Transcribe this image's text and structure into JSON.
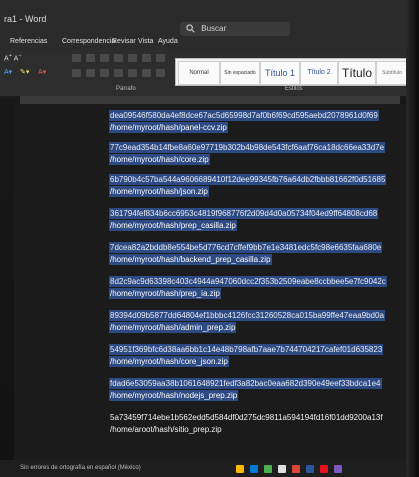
{
  "window": {
    "title": "ra1 - Word",
    "search_label": "Buscar"
  },
  "menu": {
    "items": [
      "Referencias",
      "Correspondencia",
      "Revisar",
      "Vista",
      "Ayuda"
    ]
  },
  "ribbon": {
    "group_paragraph": "Párrafo",
    "group_styles": "Estilos",
    "styles": [
      {
        "label": "Normal"
      },
      {
        "label": "Sin espaciado"
      },
      {
        "label": "Título 1"
      },
      {
        "label": "Título 2"
      },
      {
        "label": "Título"
      },
      {
        "label": "Subtítulo"
      }
    ]
  },
  "document": {
    "entries": [
      {
        "hash": "dea09546f580da4ef8dce67ac5d65998d7af0b6f69cd595aebd2078961d0f69",
        "path": "/home/myroot/hash/panel-ccv.zip"
      },
      {
        "hash": "77c9ead354b14fbe8a60e97719b302b4b98de543fcf6aaf76ca18dc66ea33d7e",
        "path": "/home/myroot/hash/core.zip"
      },
      {
        "hash": "6b790b4c57ba544a9606689410f12dee99345fb76a64db2fbbb81662f0d51685",
        "path": "/home/myroot/hash/json.zip"
      },
      {
        "hash": "361794fef834b6cc6953c4819f968776f2d09d4d0a05734f04ed9ff64808cd68",
        "path": "/home/myroot/hash/prep_casilla.zip"
      },
      {
        "hash": "7dcea82a2bddb8e554be5d776cd7cffef9bb7e1e3481edc5fc98e6635faa680e",
        "path": "/home/myroot/hash/backend_prep_casilla.zip"
      },
      {
        "hash": "8d2c9ac9d63398c403c4944a947060dcc2f353b2509eabe8ccbbee5e7fc9042c",
        "path": "/home/myroot/hash/prep_ia.zip"
      },
      {
        "hash": "89394d09b5877dd64804ef1bbbc4126fcc31260528ca015ba99ffe47eaa9bd0a",
        "path": "/home/myroot/hash/admin_prep.zip"
      },
      {
        "hash": "54951f369bfc6d38aa6bb1c14e48b798afb7aae7b744704217cafef01d635823",
        "path": "/home/myroot/hash/core_json.zip"
      },
      {
        "hash": "fdad6e53059aa38b1061648921fedf3a82bac0eaa682d390e49eef33bdca1e4",
        "path": "/home/myroot/hash/nodejs_prep.zip"
      },
      {
        "hash": "5a73459f714ebe1b562edd5d584df0d275dc9811a594194fd16f01dd9200a13f",
        "path": "/home/aroot/hash/sitio_prep.zip"
      }
    ]
  },
  "status": {
    "text": "Sin errores de ortografía en español (México)"
  },
  "colors": {
    "selection": "#2e4a82",
    "background": "#1b1b1b"
  }
}
